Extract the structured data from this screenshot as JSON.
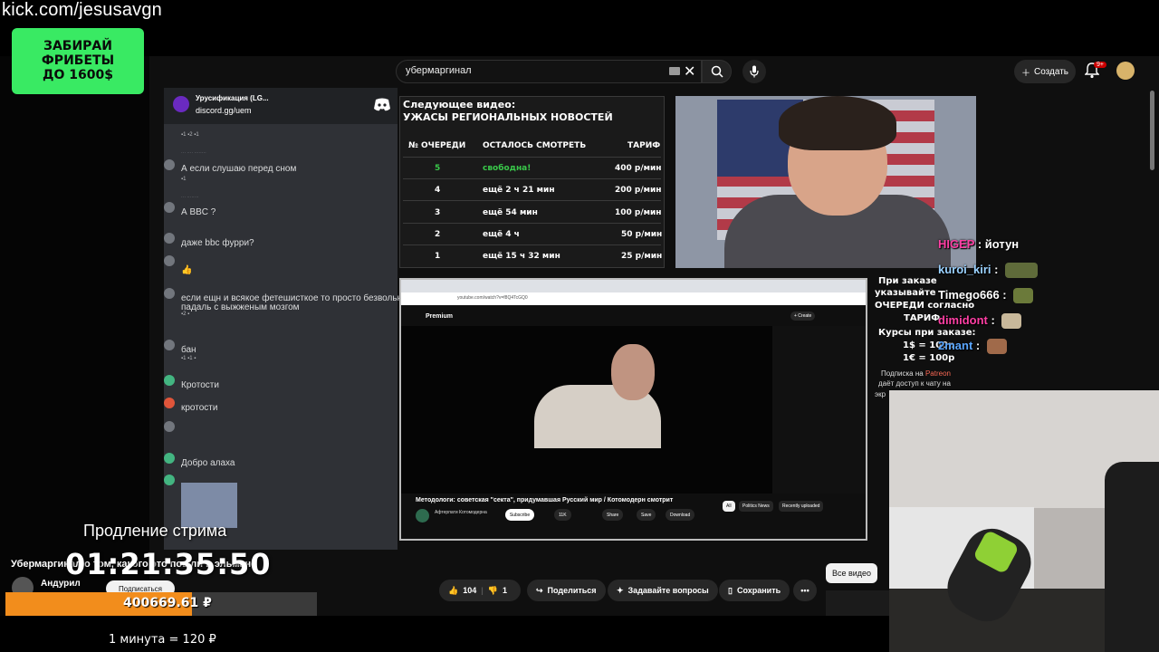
{
  "overlay": {
    "kick_url": "kick.com/jesusavgn",
    "promo_lines": [
      "ЗАБИРАЙ",
      "ФРИБЕТЫ",
      "ДО 1600$"
    ],
    "extension_label": "Продление стрима",
    "extension_timer": "01:21:35:50",
    "goal_amount": "400669.61 ₽",
    "goal_progress": 0.6,
    "rate": "1 минута = 120 ₽"
  },
  "youtube": {
    "search_value": "убермаргинал",
    "create_label": "Создать",
    "bell_badge": "9+",
    "video_title": "Убермаргинал о том, какого это пошли в эльмане",
    "channel_name": "Андурил",
    "subscribe_label": "Подписаться",
    "like_count": "104",
    "dislike_count": "1",
    "share_label": "Поделиться",
    "ask_label": "Задавайте вопросы",
    "save_label": "Сохранить",
    "all_videos_label": "Все видео"
  },
  "discord": {
    "server_title": "Урусификация (LG...",
    "invite": "discord.gg/uem",
    "messages": [
      {
        "text": "А если слушаю перед сном"
      },
      {
        "text": "А BBC ?"
      },
      {
        "text": "даже bbc фурри?"
      },
      {
        "text": "👍"
      },
      {
        "text": "если ещн и всякое фетешисткое то просто безвольная"
      },
      {
        "text": "падаль с выжженым мозгом"
      },
      {
        "text": "бан"
      },
      {
        "text": "Кротости"
      },
      {
        "text": "кротости"
      },
      {
        "text": "Добро алаха"
      }
    ]
  },
  "queue": {
    "next_label": "Следующее видео:",
    "next_title": "УЖАСЫ РЕГИОНАЛЬНЫХ НОВОСТЕЙ",
    "headers": [
      "№ ОЧЕРЕДИ",
      "ОСТАЛОСЬ СМОТРЕТЬ",
      "ТАРИФ"
    ],
    "rows": [
      [
        "5",
        "свободна!",
        "400 р/мин"
      ],
      [
        "4",
        "ещё 2 ч 21 мин",
        "200 р/мин"
      ],
      [
        "3",
        "ещё 54 мин",
        "100 р/мин"
      ],
      [
        "2",
        "ещё 4 ч",
        "50 р/мин"
      ],
      [
        "1",
        "ещё 15 ч 32 мин",
        "25 р/мин"
      ]
    ]
  },
  "info_panel": {
    "lines": [
      "При заказе",
      "указывайте",
      "ОЧЕРЕДИ согласно",
      "ТАРИФ",
      "Курсы при заказе:",
      "1$ = 100р",
      "1€ = 100р"
    ],
    "patreon_prefix": "Подписка на",
    "patreon": "Patreon",
    "patreon_line2": "даёт доступ к чату на",
    "cut_line": "экр"
  },
  "embedded": {
    "url": "youtube.com/watch?v=f8Q4TcGQ0",
    "premium_label": "Premium",
    "create_label": "+ Create",
    "video_title": "Методологи: советская \"секта\", придумавшая Русский мир / Котомодерн смотрит",
    "channel": "Афтерпати Котомодерна",
    "subscribe": "Subscribe",
    "likes": "11K",
    "share": "Share",
    "save": "Save",
    "download": "Download",
    "chips": [
      "All",
      "Politics News",
      "Recently uploaded"
    ]
  },
  "chat": [
    {
      "user": "HIGEP",
      "color": "#ff3fa4",
      "text": "йотун"
    },
    {
      "user": "kuroi_kiri",
      "color": "#9ad1ff",
      "text": ""
    },
    {
      "user": "Timego666",
      "color": "#ffffff",
      "text": ""
    },
    {
      "user": "dimidont",
      "color": "#ff3fa4",
      "text": ""
    },
    {
      "user": "2mant",
      "color": "#5aa6ff",
      "text": ""
    }
  ]
}
